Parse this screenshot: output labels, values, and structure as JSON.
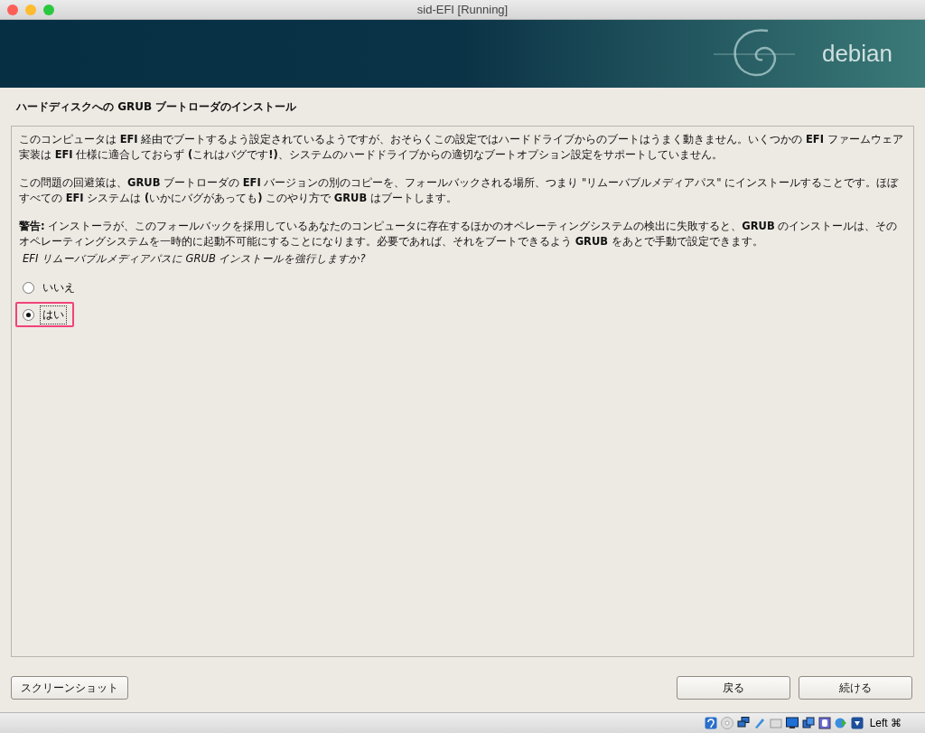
{
  "window": {
    "title": "sid-EFI [Running]"
  },
  "banner": {
    "logo_text": "debian"
  },
  "page_title": "ハードディスクへの GRUB ブートローダのインストール",
  "paragraphs": [
    "このコンピュータは **EFI** 経由でブートするよう設定されているようですが、おそらくこの設定ではハードドライブからのブートはうまく動きません。いくつかの **EFI** ファームウェア実装は **EFI** 仕様に適合しておらず **(**これはバグです**!)**、システムのハードドライブからの適切なブートオプション設定をサポートしていません。",
    "この問題の回避策は、**GRUB** ブートローダの **EFI** バージョンの別のコピーを、フォールバックされる場所、つまり \"リムーバブルメディアパス\" にインストールすることです。ほぼすべての **EFI** システムは **(**いかにバグがあっても**)** このやり方で **GRUB** はブートします。",
    "**警告:** インストーラが、このフォールバックを採用しているあなたのコンピュータに存在するほかのオペレーティングシステムの検出に失敗すると、**GRUB** のインストールは、そのオペレーティングシステムを一時的に起動不可能にすることになります。必要であれば、それをブートできるよう **GRUB** をあとで手動で設定できます。"
  ],
  "question": "EFI リムーバブルメディアパスに GRUB インストールを強行しますか?",
  "options": [
    {
      "label": "いいえ",
      "selected": false
    },
    {
      "label": "はい",
      "selected": true
    }
  ],
  "buttons": {
    "screenshot": "スクリーンショット",
    "back": "戻る",
    "continue": "続ける"
  },
  "status_bar": {
    "host_key": "Left ⌘"
  }
}
